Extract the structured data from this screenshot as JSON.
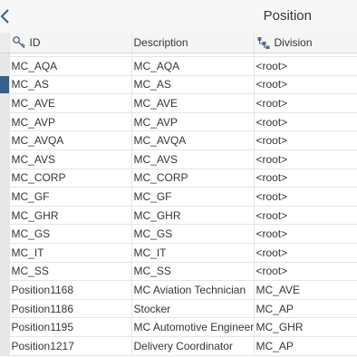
{
  "header": {
    "title": "Position"
  },
  "table": {
    "columns": {
      "id": "ID",
      "description": "Description",
      "division": "Division"
    },
    "rows": [
      {
        "id": "MC_AQA",
        "description": "MC_AQA",
        "division": "<root>"
      },
      {
        "id": "MC_AS",
        "description": "MC_AS",
        "division": "<root>"
      },
      {
        "id": "MC_AVE",
        "description": "MC_AVE",
        "division": "<root>"
      },
      {
        "id": "MC_AVP",
        "description": "MC_AVP",
        "division": "<root>"
      },
      {
        "id": "MC_AVQA",
        "description": "MC_AVQA",
        "division": "<root>"
      },
      {
        "id": "MC_AVS",
        "description": "MC_AVS",
        "division": "<root>"
      },
      {
        "id": "MC_CORP",
        "description": "MC_CORP",
        "division": "<root>"
      },
      {
        "id": "MC_GF",
        "description": "MC_GF",
        "division": "<root>"
      },
      {
        "id": "MC_GHR",
        "description": "MC_GHR",
        "division": "<root>"
      },
      {
        "id": "MC_GS",
        "description": "MC_GS",
        "division": "<root>"
      },
      {
        "id": "MC_IT",
        "description": "MC_IT",
        "division": "<root>"
      },
      {
        "id": "MC_SS",
        "description": "MC_SS",
        "division": "<root>"
      },
      {
        "id": "Position1168",
        "description": "MC Aviation Technician",
        "division": "MC_AVE"
      },
      {
        "id": "Position1186",
        "description": "Stocker",
        "division": "MC_AP"
      },
      {
        "id": "Position1195",
        "description": "MC Automotive Engineer",
        "division": "MC_GHR"
      },
      {
        "id": "Position1217",
        "description": "Delivery Coordinator",
        "division": "MC_AP"
      }
    ]
  },
  "colors": {
    "accent": "#346187",
    "header_bg": "#f7f7f7",
    "text": "#32363a"
  }
}
